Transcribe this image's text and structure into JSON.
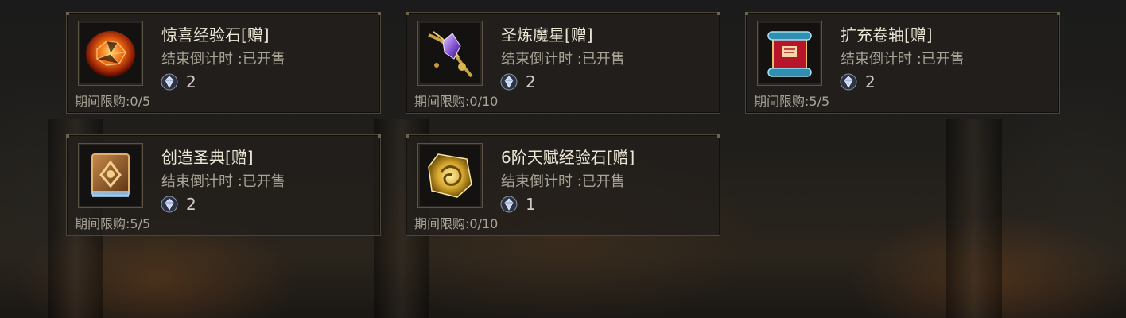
{
  "items": [
    {
      "name": "惊喜经验石[赠]",
      "timer": "结束倒计时 :已开售",
      "price": "2",
      "limit": "期间限购:0/5",
      "icon": "orange-gem-icon"
    },
    {
      "name": "圣炼魔星[赠]",
      "timer": "结束倒计时 :已开售",
      "price": "2",
      "limit": "期间限购:0/10",
      "icon": "purple-star-crystal-icon"
    },
    {
      "name": "扩充卷轴[赠]",
      "timer": "结束倒计时 :已开售",
      "price": "2",
      "limit": "期间限购:5/5",
      "icon": "scroll-icon"
    },
    {
      "name": "创造圣典[赠]",
      "timer": "结束倒计时 :已开售",
      "price": "2",
      "limit": "期间限购:5/5",
      "icon": "holy-book-icon"
    },
    {
      "name": "6阶天赋经验石[赠]",
      "timer": "结束倒计时 :已开售",
      "price": "1",
      "limit": "期间限购:0/10",
      "icon": "gold-talent-stone-icon"
    }
  ],
  "currency_icon": "diamond-currency-icon"
}
